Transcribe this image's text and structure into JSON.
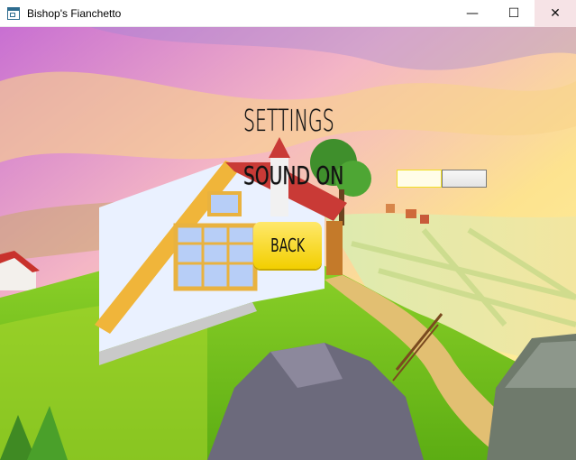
{
  "window": {
    "title": "Bishop's Fianchetto",
    "controls": {
      "minimize": "—",
      "maximize": "☐",
      "close": "✕"
    }
  },
  "settings": {
    "heading": "SETTINGS",
    "sound_label": "SOUND ON",
    "back_label": "BACK"
  },
  "colors": {
    "button_yellow": "#f5d311",
    "toggle_border": "#f1de26"
  }
}
